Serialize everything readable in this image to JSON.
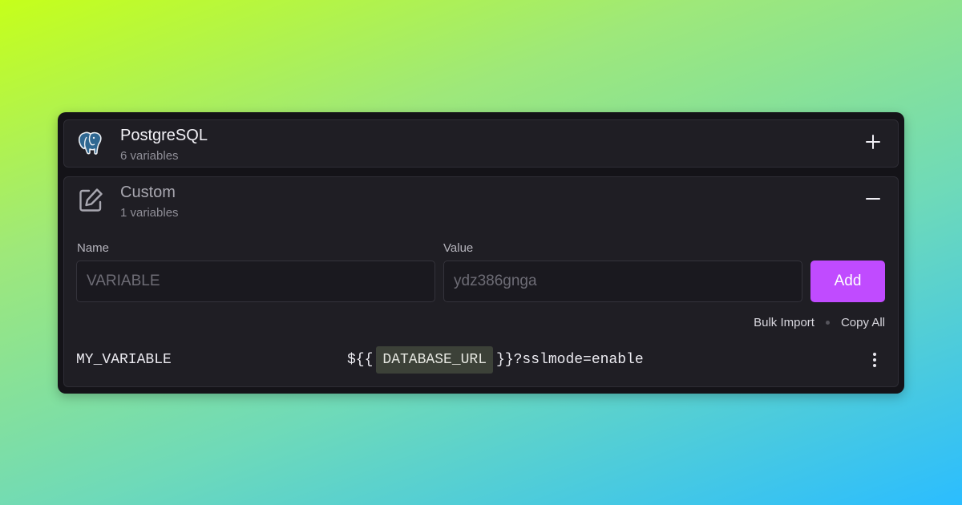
{
  "sections": {
    "postgres": {
      "title": "PostgreSQL",
      "subtitle": "6 variables",
      "icon": "postgresql-elephant-icon",
      "toggle": "plus-icon"
    },
    "custom": {
      "title": "Custom",
      "subtitle": "1 variables",
      "icon": "edit-square-icon",
      "toggle": "minus-icon"
    }
  },
  "form": {
    "name_label": "Name",
    "name_placeholder": "VARIABLE",
    "value_label": "Value",
    "value_placeholder": "ydz386gnga",
    "add_label": "Add"
  },
  "actions": {
    "bulk_import": "Bulk Import",
    "copy_all": "Copy All"
  },
  "variables": [
    {
      "name": "MY_VARIABLE",
      "value_prefix": "${{",
      "reference": "DATABASE_URL",
      "value_suffix": "}}?sslmode=enable"
    }
  ],
  "colors": {
    "accent": "#c04bff",
    "panel": "#141318",
    "section": "#1f1e24",
    "reference_chip": "#3c4138"
  }
}
